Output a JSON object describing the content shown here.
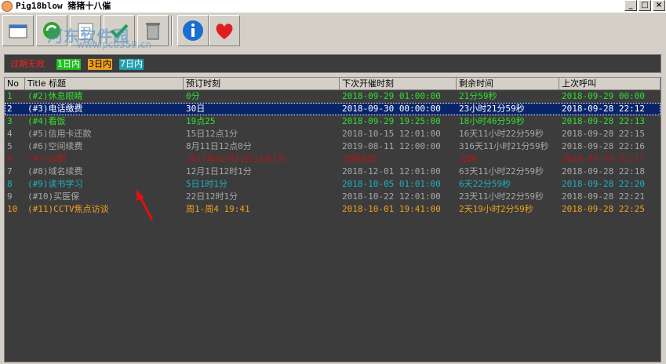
{
  "window": {
    "title": "Pig18blow 猪猪十八催",
    "min_label": "_",
    "max_label": "□",
    "close_label": "×"
  },
  "watermark": {
    "line1": "河东软件园",
    "line2": "www.pc0359.cn"
  },
  "legend": [
    {
      "label": "过期无效",
      "fg": "#ff2020",
      "bg": "#3c3c3c"
    },
    {
      "label": "1日内",
      "fg": "#ffffff",
      "bg": "#20c020"
    },
    {
      "label": "3日内",
      "fg": "#000000",
      "bg": "#f0a020"
    },
    {
      "label": "7日内",
      "fg": "#ffffff",
      "bg": "#20a0b0"
    }
  ],
  "columns": [
    "No",
    "Title 标题",
    "预订时刻",
    "下次开催时刻",
    "剩余时间",
    "上次呼叫"
  ],
  "rows": [
    {
      "no": "1",
      "title": "(#2)休息眼睛",
      "schedule": "0分",
      "next": "2018-09-29 01:00:00",
      "remain": "21分59秒",
      "last": "2018-09-29 00:00",
      "color": "#30e030",
      "selected": false
    },
    {
      "no": "2",
      "title": "(#3)电话缴费",
      "schedule": "30日",
      "next": "2018-09-30 00:00:00",
      "remain": "23小时21分59秒",
      "last": "2018-09-28 22:12",
      "color": "#ffffff",
      "selected": true
    },
    {
      "no": "3",
      "title": "(#4)看饭",
      "schedule": "19点25",
      "next": "2018-09-29 19:25:00",
      "remain": "18小时46分59秒",
      "last": "2018-09-28 22:13",
      "color": "#30e030",
      "selected": false
    },
    {
      "no": "4",
      "title": "(#5)信用卡还款",
      "schedule": "15日12点1分",
      "next": "2018-10-15 12:01:00",
      "remain": "16天11小时22分59秒",
      "last": "2018-09-28 22:15",
      "color": "#a8a8a8",
      "selected": false
    },
    {
      "no": "5",
      "title": "(#6)空间续费",
      "schedule": "8月11日12点0分",
      "next": "2019-08-11 12:00:00",
      "remain": "316天11小时21分59秒",
      "last": "2018-09-28 22:16",
      "color": "#a8a8a8",
      "selected": false
    },
    {
      "no": "6",
      "title": "(#7)过期",
      "schedule": "2017年02月21日12点1分",
      "next": "过期无效",
      "remain": "过期",
      "last": "2018-09-28 22:17",
      "color": "#b01818",
      "selected": false
    },
    {
      "no": "7",
      "title": "(#8)域名续费",
      "schedule": "12月1日12时1分",
      "next": "2018-12-01 12:01:00",
      "remain": "63天11小时22分59秒",
      "last": "2018-09-28 22:18",
      "color": "#a8a8a8",
      "selected": false
    },
    {
      "no": "8",
      "title": "(#9)读书学习",
      "schedule": "5日1时1分",
      "next": "2018-10-05 01:01:00",
      "remain": "6天22分59秒",
      "last": "2018-09-28 22:20",
      "color": "#20b0c0",
      "selected": false
    },
    {
      "no": "9",
      "title": "(#10)买医保",
      "schedule": "22日12时1分",
      "next": "2018-10-22 12:01:00",
      "remain": "23天11小时22分59秒",
      "last": "2018-09-28 22:21",
      "color": "#a8a8a8",
      "selected": false
    },
    {
      "no": "10",
      "title": "(#11)CCTV焦点访谈",
      "schedule": "周1-周4 19:41",
      "next": "2018-10-01 19:41:00",
      "remain": "2天19小时2分59秒",
      "last": "2018-09-28 22:25",
      "color": "#f0a020",
      "selected": false
    }
  ],
  "toolbar_icons": [
    "add-icon",
    "refresh-icon",
    "edit-icon",
    "check-icon",
    "delete-icon",
    "info-icon",
    "heart-icon"
  ]
}
